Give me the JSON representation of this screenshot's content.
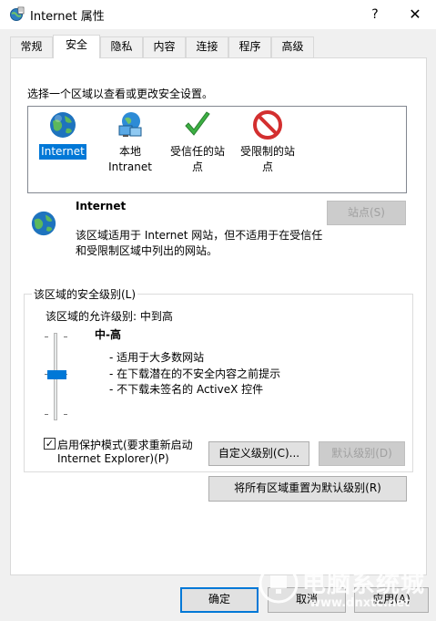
{
  "window": {
    "title": "Internet 属性",
    "help": "?",
    "close": "✕"
  },
  "tabs": [
    {
      "label": "常规"
    },
    {
      "label": "安全"
    },
    {
      "label": "隐私"
    },
    {
      "label": "内容"
    },
    {
      "label": "连接"
    },
    {
      "label": "程序"
    },
    {
      "label": "高级"
    }
  ],
  "security": {
    "instruction": "选择一个区域以查看或更改安全设置。",
    "zones": [
      {
        "label_line1": "Internet",
        "label_line2": "",
        "icon": "globe-icon"
      },
      {
        "label_line1": "本地",
        "label_line2": "Intranet",
        "icon": "intranet-icon"
      },
      {
        "label_line1": "受信任的站",
        "label_line2": "点",
        "icon": "check-icon"
      },
      {
        "label_line1": "受限制的站",
        "label_line2": "点",
        "icon": "restricted-icon"
      }
    ],
    "zone_title": "Internet",
    "zone_desc_line1": "该区域适用于 Internet 网站，但不适用于在受信任",
    "zone_desc_line2": "和受限制区域中列出的网站。",
    "sites_button": "站点(S)",
    "level_group_title": "该区域的安全级别(L)",
    "allowed_levels": "该区域的允许级别: 中到高",
    "level_name": "中-高",
    "level_points": [
      "- 适用于大多数网站",
      "- 在下载潜在的不安全内容之前提示",
      "- 不下载未签名的 ActiveX 控件"
    ],
    "slider_level": 0.5,
    "protected_mode_line1": "启用保护模式(要求重新启动",
    "protected_mode_line2": "Internet Explorer)(P)",
    "protected_mode_checked": true,
    "custom_level_button": "自定义级别(C)...",
    "default_level_button": "默认级别(D)",
    "reset_all_button": "将所有区域重置为默认级别(R)"
  },
  "footer": {
    "ok": "确定",
    "cancel": "取消",
    "apply": "应用(A)"
  },
  "watermark": {
    "line1": "电脑系统城",
    "line2": "www.dnxtc.net"
  },
  "colors": {
    "accent": "#0078d7",
    "restricted": "#d32f2f",
    "trusted": "#3cb043"
  }
}
